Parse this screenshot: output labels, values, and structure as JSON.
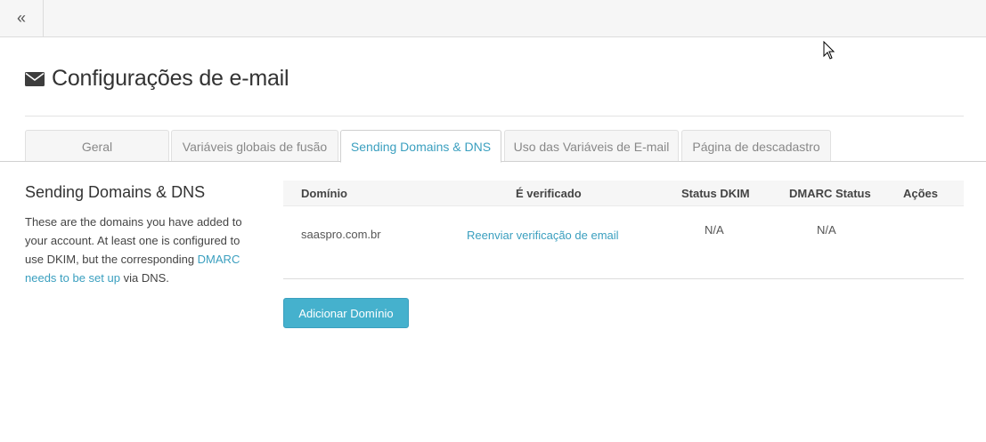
{
  "topbar": {
    "collapse_glyph": "«"
  },
  "page": {
    "icon": "envelope-icon",
    "title": "Configurações de e-mail"
  },
  "tabs": [
    {
      "label": "Geral",
      "active": false
    },
    {
      "label": "Variáveis globais de fusão",
      "active": false
    },
    {
      "label": "Sending Domains & DNS",
      "active": true
    },
    {
      "label": "Uso das Variáveis de E-mail",
      "active": false
    },
    {
      "label": "Página de descadastro",
      "active": false
    }
  ],
  "side": {
    "title": "Sending Domains & DNS",
    "text_before": "These are the domains you have added to your account. At least one is configured to use DKIM, but the corresponding ",
    "link": "DMARC needs to be set up",
    "text_after": " via DNS."
  },
  "table": {
    "headers": {
      "domain": "Domínio",
      "verified": "É verificado",
      "dkim": "Status DKIM",
      "dmarc": "DMARC Status",
      "actions": "Ações"
    },
    "rows": [
      {
        "domain": "saaspro.com.br",
        "verified_link": "Reenviar verificação de email",
        "dkim": "N/A",
        "dmarc": "N/A"
      }
    ]
  },
  "buttons": {
    "add_domain": "Adicionar Domínio"
  },
  "colors": {
    "accent": "#3a9fbf",
    "button": "#45b1cd",
    "text": "#333333",
    "muted": "#888888"
  }
}
